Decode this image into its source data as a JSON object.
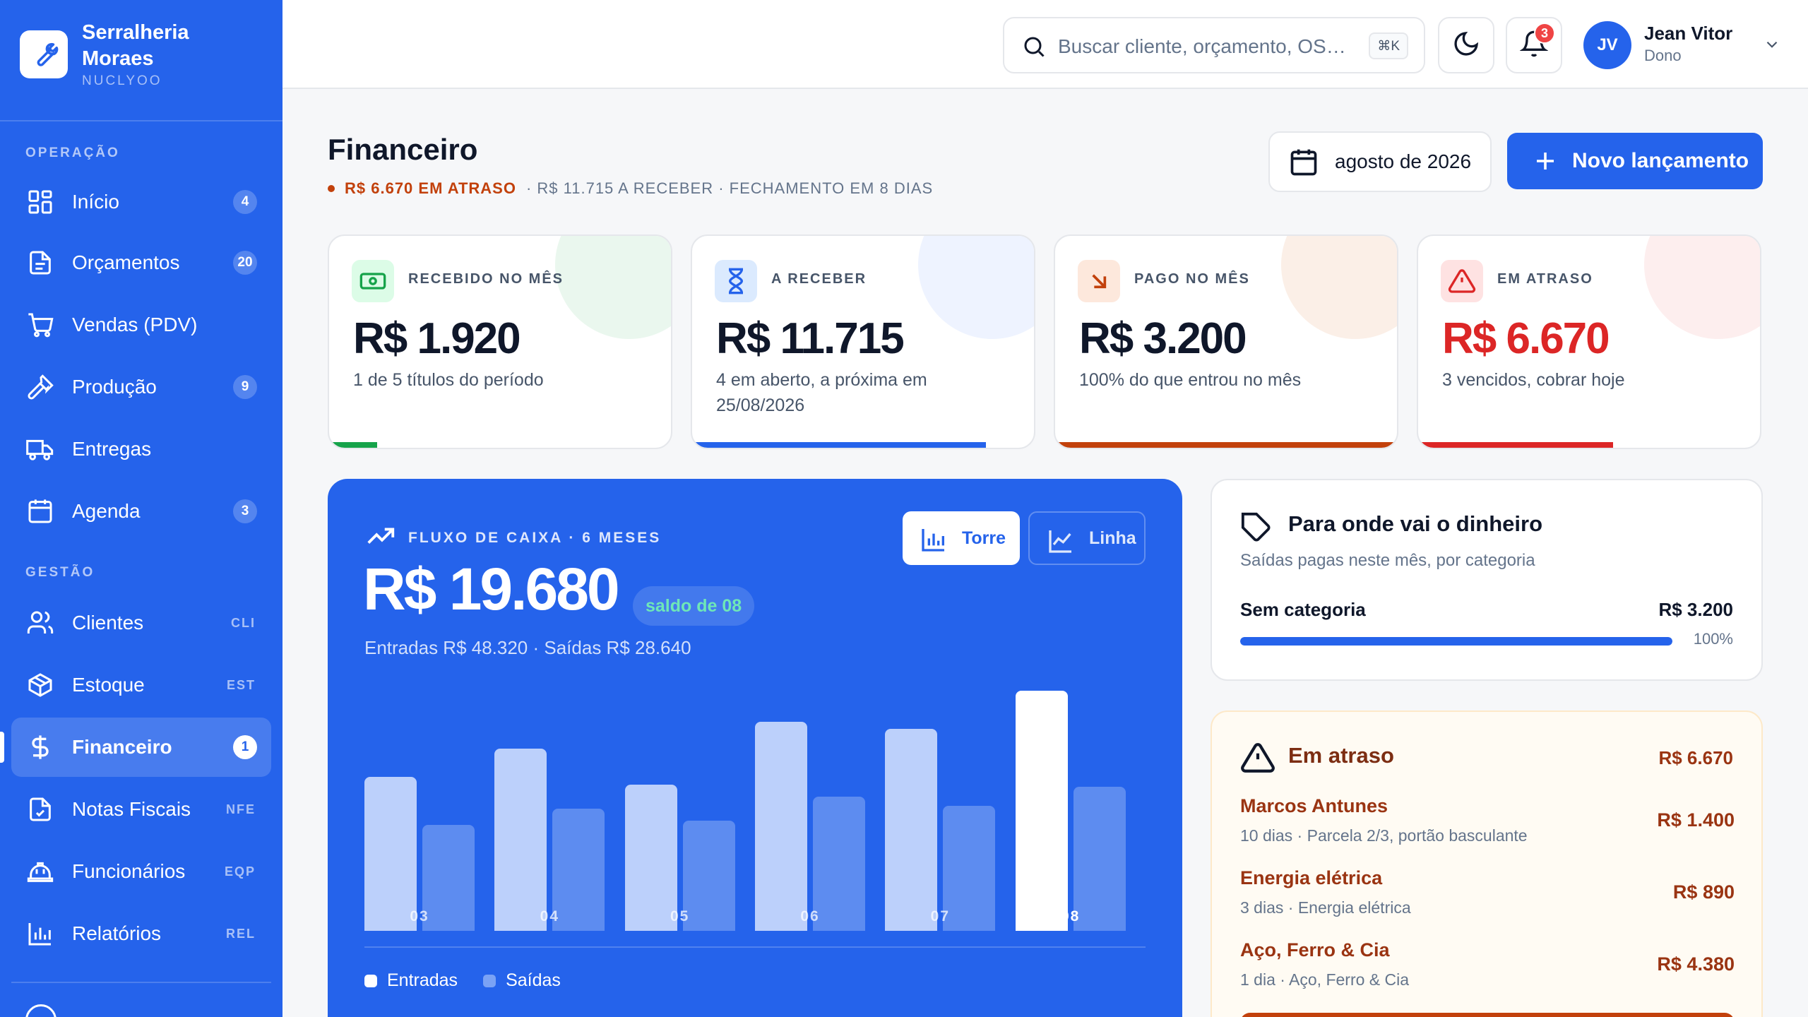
{
  "brand": {
    "name": "Serralheria Moraes",
    "sub": "NUCLYOO"
  },
  "sidebar": {
    "sections": {
      "ops": "OPERAÇÃO",
      "mgmt": "GESTÃO"
    },
    "items": [
      {
        "label": "Início",
        "badge": "4"
      },
      {
        "label": "Orçamentos",
        "badge": "20"
      },
      {
        "label": "Vendas (PDV)",
        "badge": ""
      },
      {
        "label": "Produção",
        "badge": "9"
      },
      {
        "label": "Entregas",
        "badge": ""
      },
      {
        "label": "Agenda",
        "badge": "3"
      },
      {
        "label": "Clientes",
        "code": "CLI"
      },
      {
        "label": "Estoque",
        "code": "EST"
      },
      {
        "label": "Financeiro",
        "badge": "1"
      },
      {
        "label": "Notas Fiscais",
        "code": "NFE"
      },
      {
        "label": "Funcionários",
        "code": "EQP"
      },
      {
        "label": "Relatórios",
        "code": "REL"
      }
    ]
  },
  "topbar": {
    "search_placeholder": "Buscar cliente, orçamento, OS…",
    "search_shortcut": "⌘K",
    "notifications_count": "3",
    "user": {
      "initials": "JV",
      "name": "Jean Vitor",
      "role": "Dono"
    }
  },
  "header": {
    "title": "Financeiro",
    "overdue": "R$ 6.670 EM ATRASO",
    "rest": "· R$ 11.715 A RECEBER · FECHAMENTO EM 8 DIAS",
    "month": "agosto de 2026",
    "new_button": "Novo lançamento"
  },
  "kpis": [
    {
      "label": "RECEBIDO NO MÊS",
      "value": "R$ 1.920",
      "desc": "1 de 5 títulos do período",
      "color": "#16a34a",
      "progress": 0.14
    },
    {
      "label": "A RECEBER",
      "value": "R$ 11.715",
      "desc": "4 em aberto, a próxima em 25/08/2026",
      "color": "#2563eb",
      "progress": 0.86
    },
    {
      "label": "PAGO NO MÊS",
      "value": "R$ 3.200",
      "desc": "100% do que entrou no mês",
      "color": "#c2410c",
      "progress": 1.0
    },
    {
      "label": "EM ATRASO",
      "value": "R$ 6.670",
      "desc": "3 vencidos, cobrar hoje",
      "color": "#dc2626",
      "progress": 0.57
    }
  ],
  "cashflow": {
    "label": "FLUXO DE CAIXA · 6 MESES",
    "value": "R$ 19.680",
    "pill": "saldo de 08",
    "io": "Entradas R$ 48.320 · Saídas R$ 28.640",
    "toggle_on": "Torre",
    "toggle_off": "Linha",
    "legend_in": "Entradas",
    "legend_out": "Saídas"
  },
  "chart_data": {
    "type": "bar",
    "categories": [
      "03",
      "04",
      "05",
      "06",
      "07",
      "08"
    ],
    "series": [
      {
        "name": "Entradas",
        "values": [
          0.64,
          0.76,
          0.61,
          0.87,
          0.84,
          1.0
        ]
      },
      {
        "name": "Saídas",
        "values": [
          0.44,
          0.51,
          0.46,
          0.56,
          0.52,
          0.6
        ]
      }
    ],
    "highlight_index": 5,
    "legend": "bottom-left"
  },
  "spending": {
    "title": "Para onde vai o dinheiro",
    "sub": "Saídas pagas neste mês, por categoria",
    "categories": [
      {
        "name": "Sem categoria",
        "amount": "R$ 3.200",
        "pct": "100%",
        "share": 1.0
      }
    ]
  },
  "overdue": {
    "title": "Em atraso",
    "total": "R$ 6.670",
    "items": [
      {
        "name": "Marcos Antunes",
        "detail": "10 dias · Parcela 2/3, portão basculante",
        "amount": "R$ 1.400"
      },
      {
        "name": "Energia elétrica",
        "detail": "3 dias · Energia elétrica",
        "amount": "R$ 890"
      },
      {
        "name": "Aço, Ferro & Cia",
        "detail": "1 dia · Aço, Ferro & Cia",
        "amount": "R$ 4.380"
      }
    ]
  }
}
